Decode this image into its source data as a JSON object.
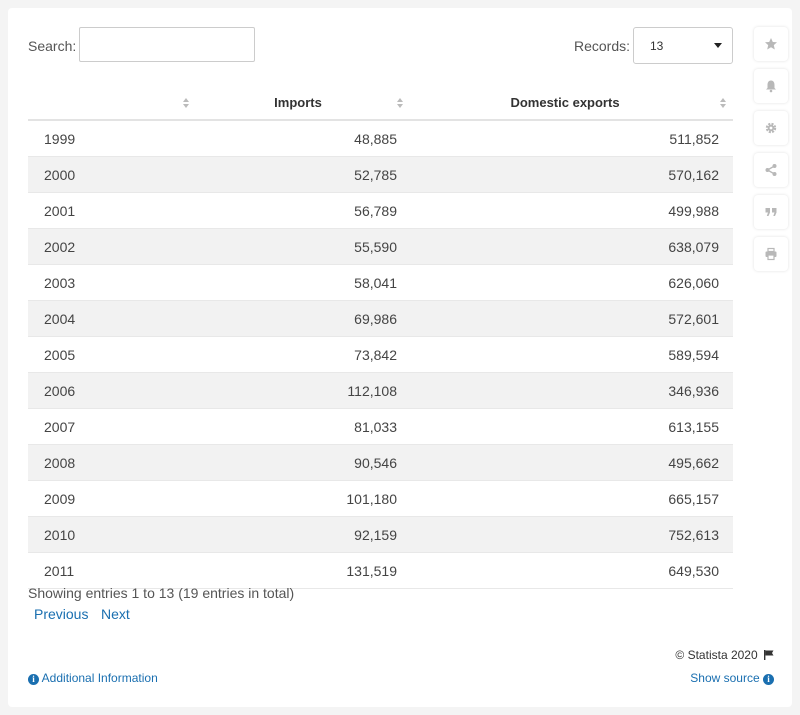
{
  "search": {
    "label": "Search:",
    "value": ""
  },
  "records": {
    "label": "Records:",
    "value": "13"
  },
  "table": {
    "headers": [
      "",
      "Imports",
      "Domestic exports"
    ],
    "rows": [
      [
        "1999",
        "48,885",
        "511,852"
      ],
      [
        "2000",
        "52,785",
        "570,162"
      ],
      [
        "2001",
        "56,789",
        "499,988"
      ],
      [
        "2002",
        "55,590",
        "638,079"
      ],
      [
        "2003",
        "58,041",
        "626,060"
      ],
      [
        "2004",
        "69,986",
        "572,601"
      ],
      [
        "2005",
        "73,842",
        "589,594"
      ],
      [
        "2006",
        "112,108",
        "346,936"
      ],
      [
        "2007",
        "81,033",
        "613,155"
      ],
      [
        "2008",
        "90,546",
        "495,662"
      ],
      [
        "2009",
        "101,180",
        "665,157"
      ],
      [
        "2010",
        "92,159",
        "752,613"
      ],
      [
        "2011",
        "131,519",
        "649,530"
      ]
    ]
  },
  "pagination": {
    "info": "Showing entries 1 to 13 (19 entries in total)",
    "previous": "Previous",
    "next": "Next"
  },
  "footer": {
    "copyright": "© Statista 2020",
    "additional_info": "Additional Information",
    "show_source": "Show source"
  },
  "sidebar": {
    "icons": [
      "star-icon",
      "bell-icon",
      "gear-icon",
      "share-icon",
      "quote-icon",
      "print-icon"
    ]
  },
  "colors": {
    "link": "#1a6fb0",
    "row_alt": "#f2f2f2",
    "icon": "#b8b8b8"
  }
}
